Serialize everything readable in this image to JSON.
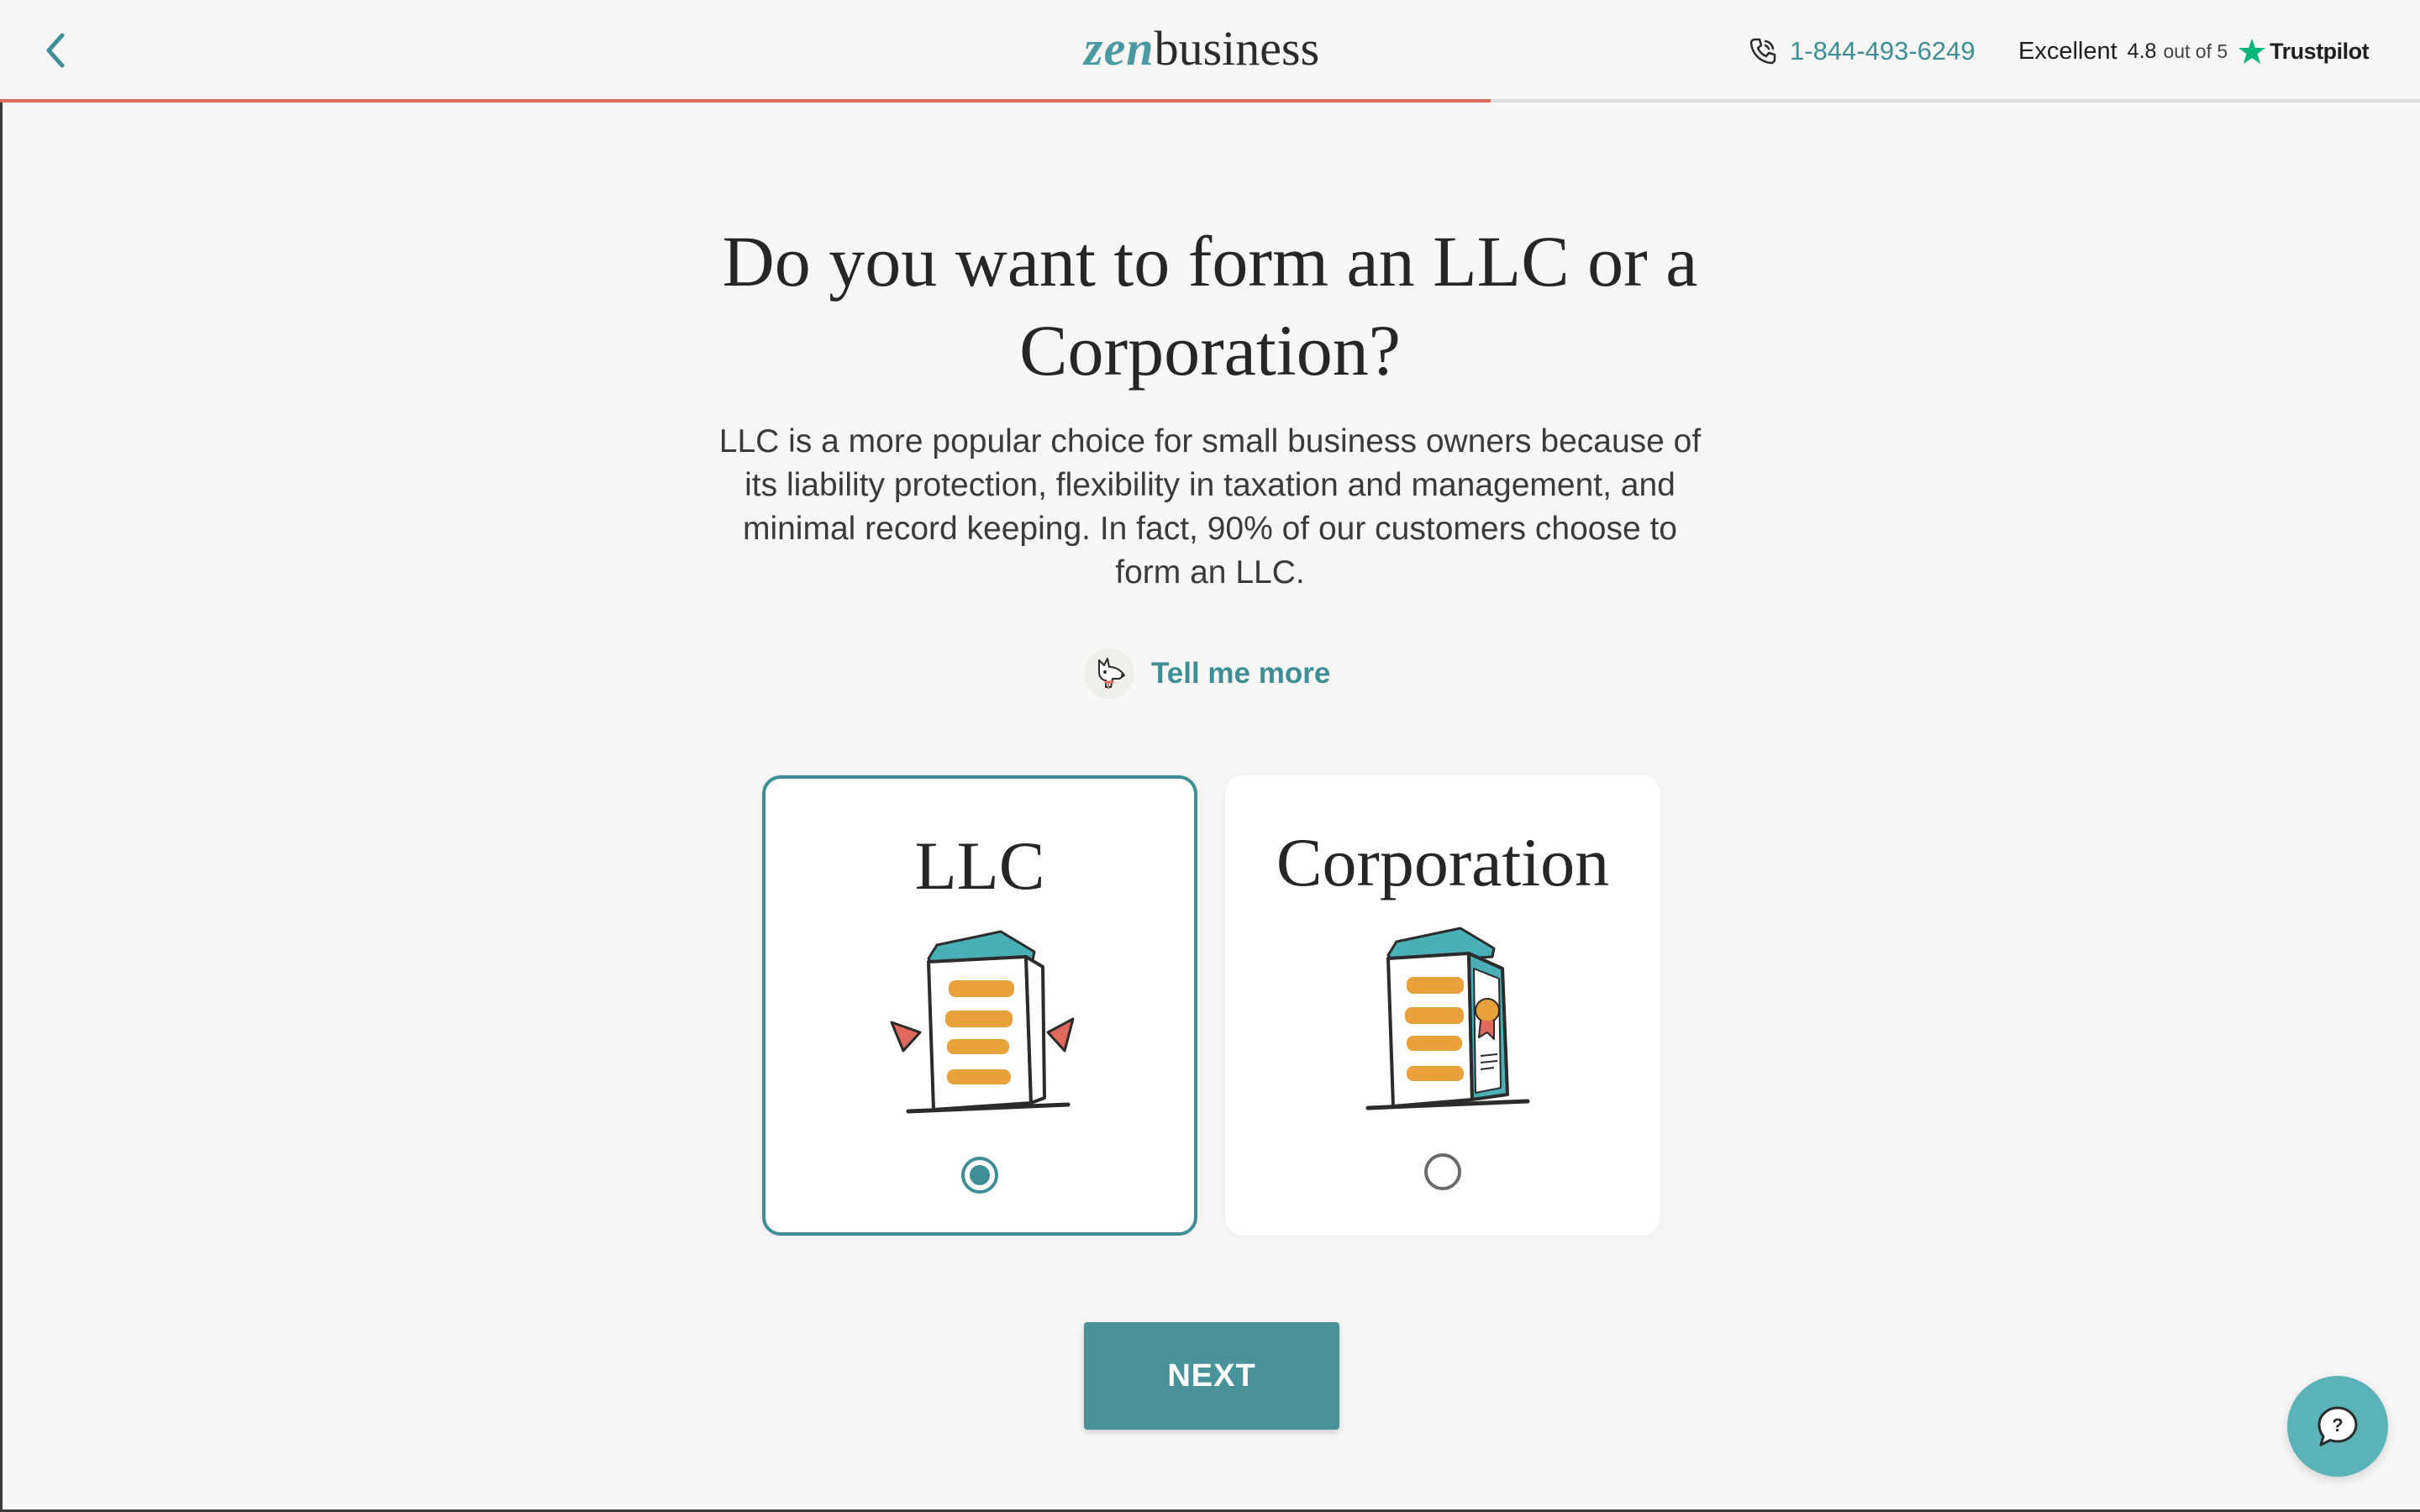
{
  "header": {
    "logo_zen": "zen",
    "logo_business": "business",
    "phone": "1-844-493-6249",
    "trustpilot": {
      "rating_word": "Excellent",
      "score": "4.8",
      "out_of": "out of 5",
      "brand": "Trustpilot"
    },
    "progress_fraction": 0.616
  },
  "main": {
    "title": "Do you want to form an LLC or a Corporation?",
    "description": "LLC is a more popular choice for small business owners because of its liability protection, flexibility in taxation and management, and minimal record keeping. In fact, 90% of our customers choose to form an LLC.",
    "tell_more": "Tell me more",
    "options": [
      {
        "label": "LLC",
        "selected": true
      },
      {
        "label": "Corporation",
        "selected": false
      }
    ],
    "next_label": "NEXT"
  },
  "colors": {
    "accent": "#3d8e95",
    "progress": "#e0695c",
    "button": "#4a9299",
    "help_button": "#5ab3b9",
    "illustration_orange": "#e9a23b",
    "illustration_teal": "#4ab0b7",
    "illustration_red": "#e0695c"
  },
  "icons": {
    "back": "chevron-left-icon",
    "phone": "phone-icon",
    "star": "trustpilot-star-icon",
    "dog": "dog-mascot-icon",
    "help": "chat-help-icon"
  }
}
